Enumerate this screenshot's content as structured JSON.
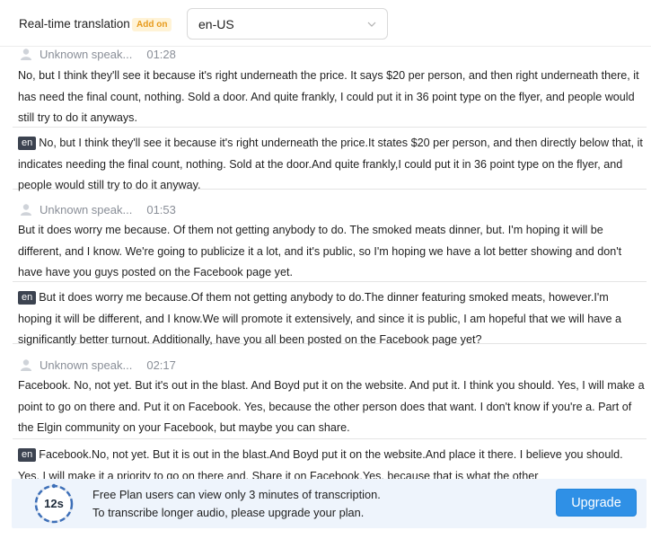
{
  "header": {
    "title": "Real-time translation",
    "addon_badge": "Add on",
    "language": "en-US"
  },
  "transcript": [
    {
      "speaker": "Unknown speak...",
      "time": "01:28",
      "text": "No, but I think they'll see it because it's right underneath the price. It says $20 per person, and then right underneath there, it has need the final count, nothing. Sold a door. And quite frankly, I could put it in 36 point type on the flyer, and people would still try to do it anyways.",
      "translation_tag": "en",
      "translation": "No, but I think they'll see it because it's right underneath the price.It states $20 per person, and then directly below that, it indicates needing the final count, nothing. Sold at the door.And quite frankly,I could put it in 36 point type on the flyer, and people would still try to do it anyway."
    },
    {
      "speaker": "Unknown speak...",
      "time": "01:53",
      "text": "But it does worry me because. Of them not getting anybody to do. The smoked meats dinner, but. I'm hoping it will be different, and I know. We're going to publicize it a lot, and it's public, so I'm hoping we have a lot better showing and don't have have you guys posted on the Facebook page yet.",
      "translation_tag": "en",
      "translation": "But it does worry me because.Of them not getting anybody to do.The dinner featuring smoked meats, however.I'm hoping it will be different, and I know.We will promote it extensively, and since it is public, I am hopeful that we will have a significantly better turnout. Additionally, have you all been posted on the Facebook page yet?"
    },
    {
      "speaker": "Unknown speak...",
      "time": "02:17",
      "text": "Facebook. No, not yet. But it's out in the blast. And Boyd put it on the website. And put it. I think you should. Yes, I will make a point to go on there and. Put it on Facebook. Yes, because the other person does that want. I don't know if you're a. Part of the Elgin community on your Facebook, but maybe you can share.",
      "translation_tag": "en",
      "translation": "Facebook.No, not yet. But it is out in the blast.And Boyd put it on the website.And place it there. I believe you should. Yes, I will make it a priority to go on there and. Share it on Facebook.Yes, because that is what the other"
    }
  ],
  "banner": {
    "timer": "12s",
    "line1": "Free Plan users can view only 3 minutes of transcription.",
    "line2": "To transcribe longer audio, please upgrade your plan.",
    "upgrade_label": "Upgrade"
  },
  "colors": {
    "accent": "#2f90e6",
    "addon_text": "#e79a1b",
    "addon_bg": "#fff3d6",
    "tag_bg": "#3c4350",
    "banner_bg": "#eef4fc"
  }
}
